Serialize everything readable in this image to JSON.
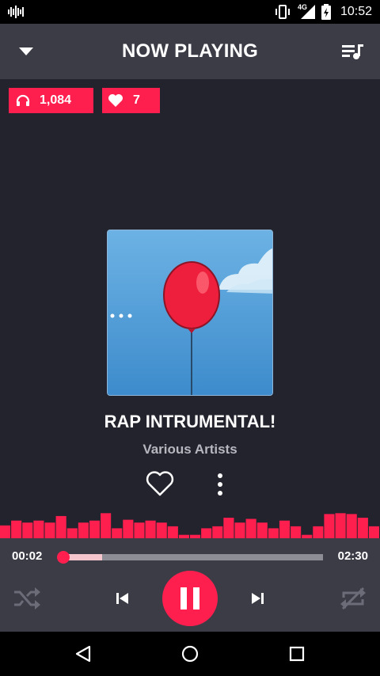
{
  "status_bar": {
    "time": "10:52",
    "network": "4G",
    "icons": [
      "soundwave-icon",
      "vibrate-icon",
      "signal-icon",
      "battery-icon"
    ]
  },
  "app_bar": {
    "title": "NOW PLAYING",
    "left_icon": "chevron-down-icon",
    "right_icon": "queue-music-icon"
  },
  "stats": {
    "listens": "1,084",
    "likes": "7"
  },
  "track": {
    "title": "RAP INTRUMENTAL!",
    "artist": "Various Artists"
  },
  "player": {
    "elapsed": "00:02",
    "total": "02:30",
    "progress_fraction": 0.013,
    "buffered_fraction": 0.16,
    "state": "playing"
  },
  "visualizer": {
    "levels": [
      0.45,
      0.62,
      0.55,
      0.62,
      0.55,
      0.78,
      0.35,
      0.55,
      0.62,
      0.88,
      0.35,
      0.65,
      0.55,
      0.62,
      0.55,
      0.42,
      0.12,
      0.12,
      0.35,
      0.42,
      0.72,
      0.55,
      0.68,
      0.55,
      0.35,
      0.62,
      0.42,
      0.12,
      0.42,
      0.85,
      0.88,
      0.85,
      0.72,
      0.42
    ]
  },
  "colors": {
    "accent": "#ff1f4f",
    "background": "#23232d",
    "panel": "#3c3c47",
    "muted_text": "#b7b7c0"
  }
}
